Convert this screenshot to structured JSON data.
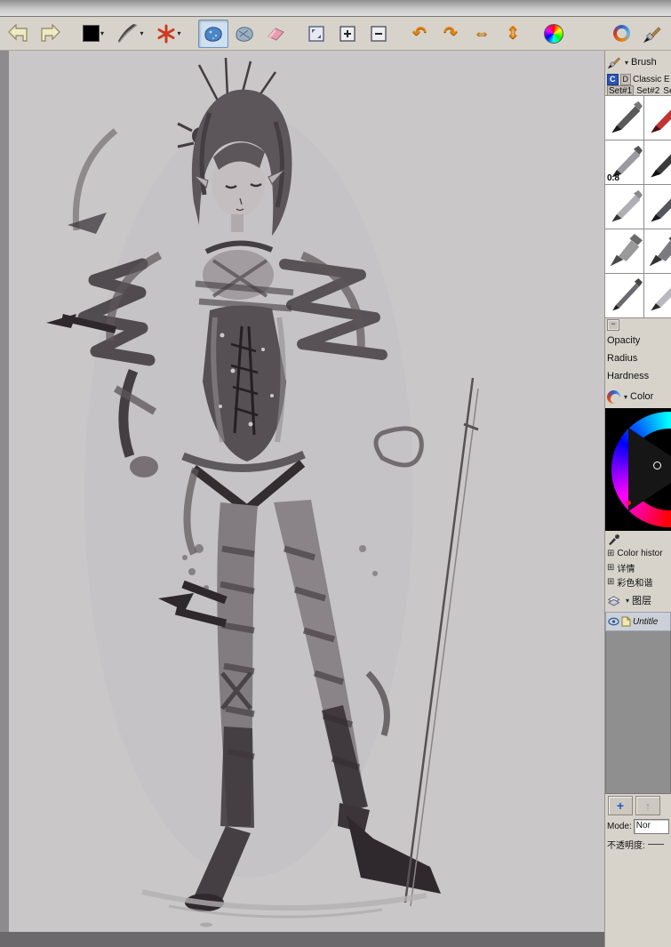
{
  "ui": {
    "caret": "▾",
    "expander_glyph": "⊞",
    "collapse_glyph": "−",
    "add_glyph": "+",
    "raise_glyph": "↑",
    "rotate_left": "↶",
    "rotate_right": "↷",
    "flip_h": "⇔",
    "flip_v": "⇕"
  },
  "colors": {
    "toolbar_bg": "#d7d3cb",
    "canvas_bg": "#c9c7c8",
    "active_tool_bg": "#cfe0f2",
    "selected_group_blue": "#2a52b8",
    "arrow_orange": "#e8830f",
    "layer_list_bg": "#8f8f90"
  },
  "brush_panel": {
    "title": "Brush",
    "groups": [
      {
        "label": "C"
      },
      {
        "label": "D"
      }
    ],
    "group_name": "Classic Exp",
    "sets": [
      "Set#1",
      "Set#2",
      "Se"
    ],
    "size_badge": "0.8",
    "sliders": [
      "Opacity",
      "Radius",
      "Hardness"
    ]
  },
  "color_panel": {
    "title": "Color",
    "expanders": [
      "Color histor",
      "详情",
      "彩色和谐"
    ]
  },
  "layers_panel": {
    "title": "图层",
    "layer_name": "Untitle",
    "mode_label": "Mode:",
    "mode_value": "Nor",
    "opacity_label": "不透明度:"
  }
}
